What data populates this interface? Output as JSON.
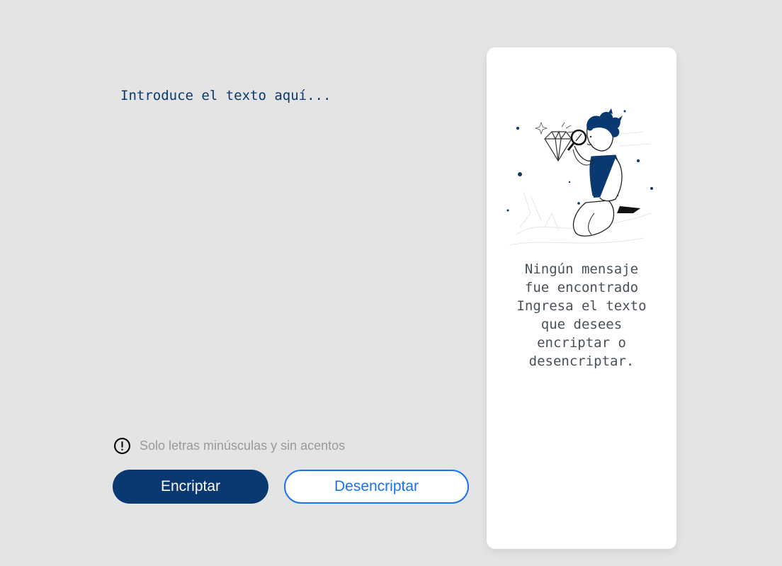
{
  "input": {
    "placeholder": "Introduce el texto aquí...",
    "value": ""
  },
  "hint": {
    "icon": "exclamation-circle-icon",
    "text": "Solo letras minúsculas y sin acentos"
  },
  "buttons": {
    "encrypt_label": "Encriptar",
    "decrypt_label": "Desencriptar"
  },
  "output": {
    "illustration": "person-with-magnifying-glass-and-diamond",
    "title": "Ningún mensaje fue encontrado",
    "subtitle": "Ingresa el texto que desees encriptar o desencriptar.",
    "lines": [
      "Ningún mensaje",
      "fue encontrado",
      "Ingresa el texto",
      "que desees",
      "encriptar o",
      "desencriptar."
    ]
  },
  "colors": {
    "background": "#e4e4e4",
    "primary": "#0a3871",
    "accent_blue": "#1a73e8",
    "hint_gray": "#9a9a9a",
    "panel_bg": "#ffffff",
    "message_text": "#495057"
  }
}
